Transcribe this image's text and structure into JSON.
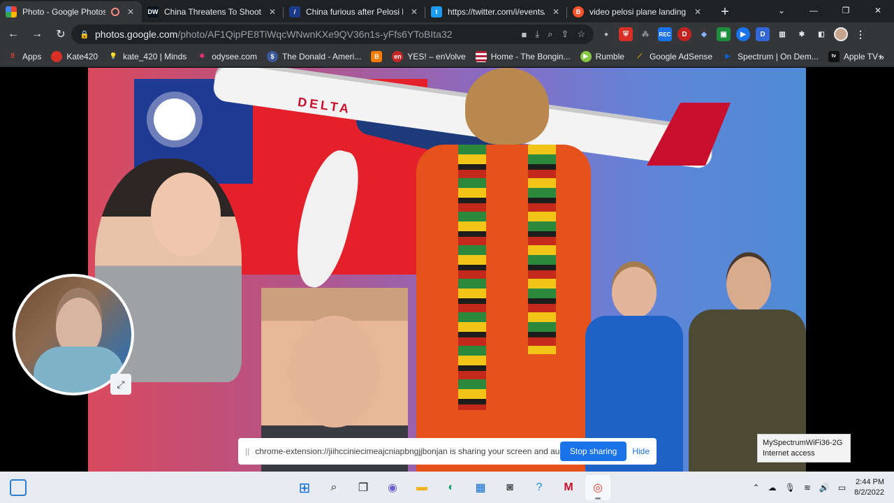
{
  "browser": {
    "tabs": [
      {
        "title": "Photo - Google Photos",
        "icon": "google-photos-icon",
        "active": true
      },
      {
        "title": "China Threatens To Shoot Do",
        "icon": "dw-icon",
        "active": false
      },
      {
        "title": "China furious after Pelosi lan",
        "icon": "news-icon",
        "active": false
      },
      {
        "title": "https://twitter.com/i/events/",
        "icon": "twitter-icon",
        "active": false
      },
      {
        "title": "video pelosi plane landing ta",
        "icon": "brave-icon",
        "active": false
      }
    ],
    "url_host": "photos.google.com",
    "url_path": "/photo/AF1QipPE8TiWqcWNwnKXe9QV36n1s-yFfs6YToBIta32"
  },
  "bookmarks": [
    {
      "label": "Apps",
      "icon": "apps-grid-icon",
      "color": "#ea4335"
    },
    {
      "label": "Kate420",
      "icon": "red-dot-icon",
      "color": "#d93025"
    },
    {
      "label": "kate_420 | Minds",
      "icon": "minds-bulb-icon",
      "color": "#f4c20d"
    },
    {
      "label": "odysee.com",
      "icon": "odysee-icon",
      "color": "#e5307a"
    },
    {
      "label": "The Donald - Ameri...",
      "icon": "donald-icon",
      "color": "#3b5998"
    },
    {
      "label": "",
      "icon": "blogger-icon",
      "color": "#f57d00"
    },
    {
      "label": "YES! – enVolve",
      "icon": "envolve-icon",
      "color": "#c62828"
    },
    {
      "label": "Home - The Bongin...",
      "icon": "flag-icon",
      "color": "#b22234"
    },
    {
      "label": "Rumble",
      "icon": "rumble-icon",
      "color": "#85c742"
    },
    {
      "label": "Google AdSense",
      "icon": "adsense-icon",
      "color": "#fbbc04"
    },
    {
      "label": "Spectrum | On Dem...",
      "icon": "spectrum-icon",
      "color": "#0a63d6"
    },
    {
      "label": "Apple TV+",
      "icon": "appletv-icon",
      "color": "#111111"
    }
  ],
  "photo": {
    "plane_text": "DELTA"
  },
  "share_bar": {
    "message": "chrome-extension://jiihcciniecimeajcniapbngjjbonjan is sharing your screen and audio.",
    "stop_label": "Stop sharing",
    "hide_label": "Hide"
  },
  "wifi_tooltip": {
    "network": "MySpectrumWiFi36-2G",
    "status": "Internet access"
  },
  "taskbar": {
    "time": "2:44 PM",
    "date": "8/2/2022"
  }
}
